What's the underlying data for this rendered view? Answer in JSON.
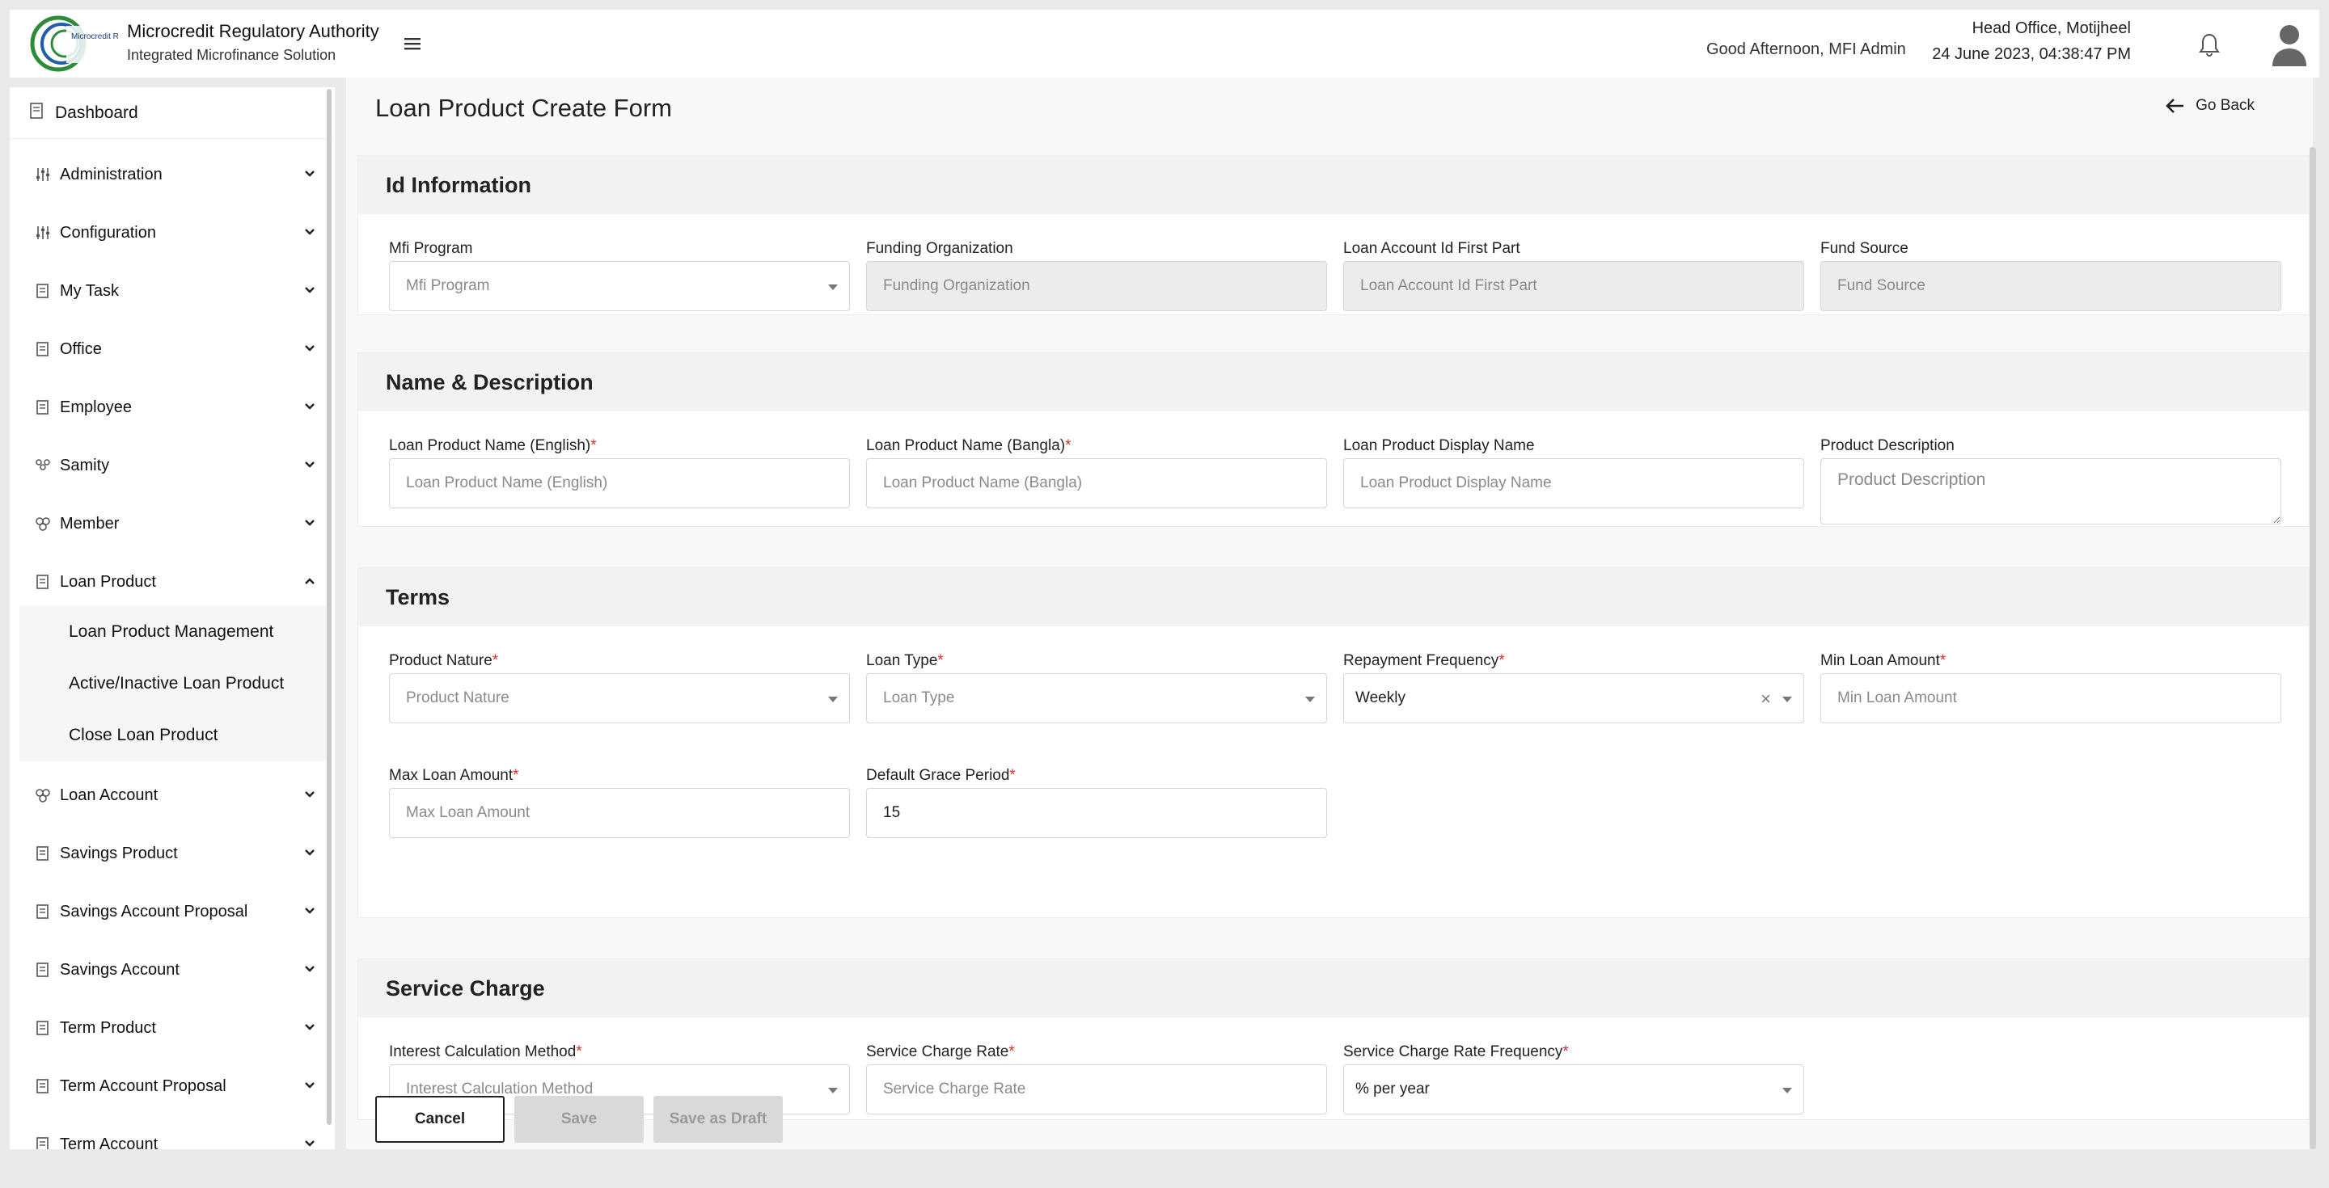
{
  "header": {
    "org_title": "Microcredit Regulatory Authority",
    "org_subtitle": "Integrated Microfinance Solution",
    "logo_text": "Microcredit Regulatory Authority",
    "greeting": "Good Afternoon, MFI Admin",
    "office": "Head Office, Motijheel",
    "datetime": "24 June 2023, 04:38:47 PM"
  },
  "sidebar": {
    "dashboard": "Dashboard",
    "items": [
      {
        "label": "Administration"
      },
      {
        "label": "Configuration"
      },
      {
        "label": "My Task"
      },
      {
        "label": "Office"
      },
      {
        "label": "Employee"
      },
      {
        "label": "Samity"
      },
      {
        "label": "Member"
      },
      {
        "label": "Loan Product"
      },
      {
        "label": "Loan Account"
      },
      {
        "label": "Savings Product"
      },
      {
        "label": "Savings Account Proposal"
      },
      {
        "label": "Savings Account"
      },
      {
        "label": "Term Product"
      },
      {
        "label": "Term Account Proposal"
      },
      {
        "label": "Term Account"
      }
    ],
    "loan_product_sub": [
      {
        "label": "Loan Product Management"
      },
      {
        "label": "Active/Inactive Loan Product"
      },
      {
        "label": "Close Loan Product"
      }
    ]
  },
  "main": {
    "title": "Loan Product Create Form",
    "go_back": "Go Back",
    "sections": {
      "id_info": {
        "title": "Id Information",
        "mfi_program": {
          "label": "Mfi Program",
          "placeholder": "Mfi Program"
        },
        "funding_org": {
          "label": "Funding Organization",
          "placeholder": "Funding Organization"
        },
        "loan_acc_id": {
          "label": "Loan Account Id First Part",
          "placeholder": "Loan Account Id First Part"
        },
        "fund_source": {
          "label": "Fund Source",
          "placeholder": "Fund Source"
        }
      },
      "name_desc": {
        "title": "Name & Description",
        "name_en": {
          "label": "Loan Product Name (English)",
          "placeholder": "Loan Product Name (English)"
        },
        "name_bn": {
          "label": "Loan Product Name (Bangla)",
          "placeholder": "Loan Product Name (Bangla)"
        },
        "display_name": {
          "label": "Loan Product Display Name",
          "placeholder": "Loan Product Display Name"
        },
        "description": {
          "label": "Product Description",
          "placeholder": "Product Description"
        }
      },
      "terms": {
        "title": "Terms",
        "product_nature": {
          "label": "Product Nature",
          "placeholder": "Product Nature"
        },
        "loan_type": {
          "label": "Loan Type",
          "placeholder": "Loan Type"
        },
        "repayment_freq": {
          "label": "Repayment Frequency",
          "value": "Weekly"
        },
        "min_amount": {
          "label": "Min Loan Amount",
          "placeholder": "Min Loan Amount"
        },
        "max_amount": {
          "label": "Max Loan Amount",
          "placeholder": "Max Loan Amount"
        },
        "grace_period": {
          "label": "Default Grace Period",
          "value": "15"
        }
      },
      "service_charge": {
        "title": "Service Charge",
        "calc_method": {
          "label": "Interest Calculation Method",
          "placeholder": "Interest Calculation Method"
        },
        "rate": {
          "label": "Service Charge Rate",
          "placeholder": "Service Charge Rate"
        },
        "rate_freq": {
          "label": "Service Charge Rate Frequency",
          "value": "% per year"
        }
      }
    },
    "buttons": {
      "cancel": "Cancel",
      "save": "Save",
      "save_draft": "Save as Draft"
    },
    "required_mark": "*"
  },
  "colors": {
    "required": "#d32f2f",
    "section_head": "#f2f2f2",
    "disabled_input": "#ececec"
  }
}
